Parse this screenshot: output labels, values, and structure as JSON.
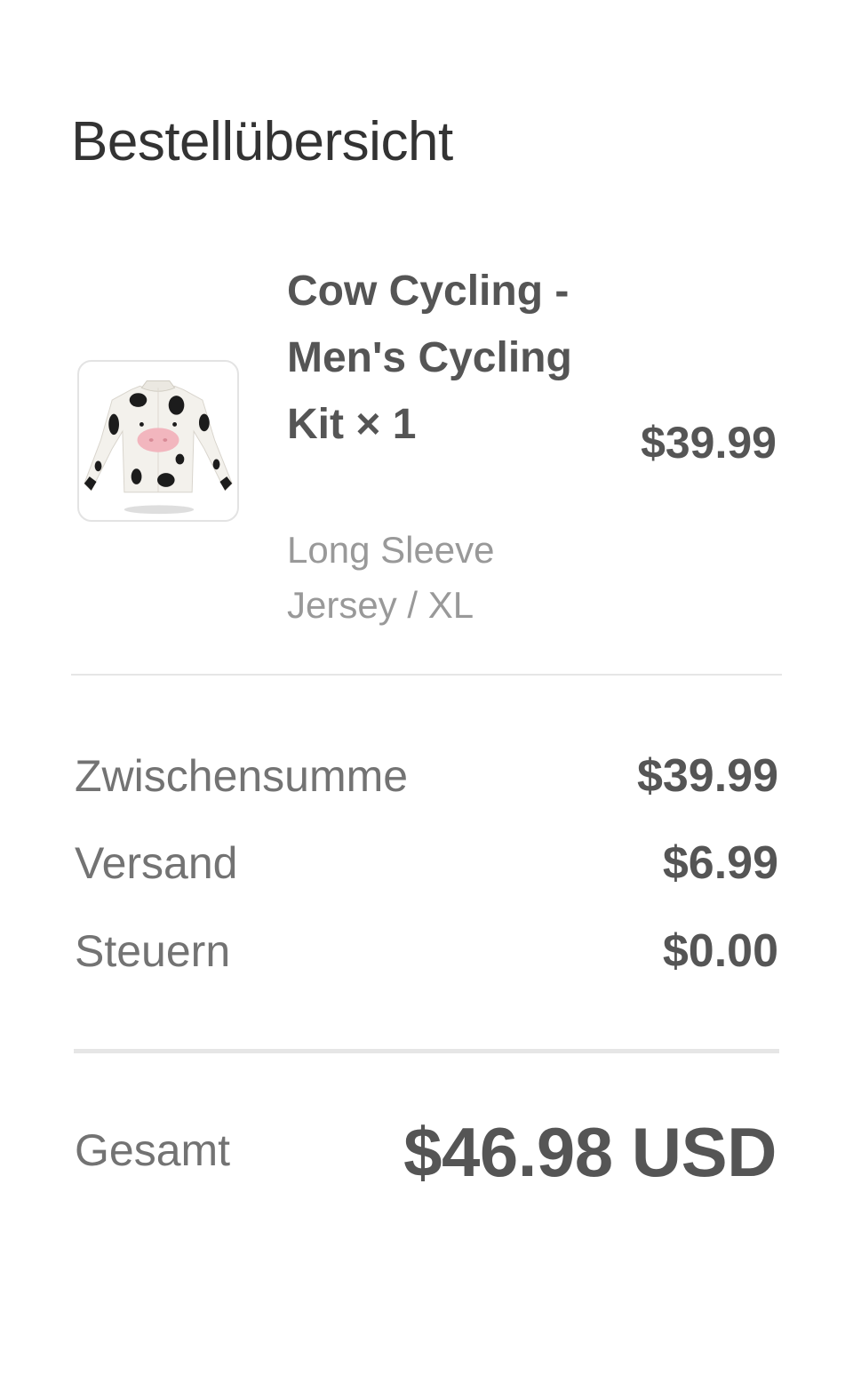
{
  "header": {
    "title": "Bestellübersicht"
  },
  "line_item": {
    "name": "Cow Cycling - Men's Cycling Kit × 1",
    "variant": "Long Sleeve Jersey / XL",
    "price": "$39.99",
    "image_icon": "cow-print-jersey-image"
  },
  "summary": {
    "subtotal_label": "Zwischensumme",
    "subtotal_value": "$39.99",
    "shipping_label": "Versand",
    "shipping_value": "$6.99",
    "taxes_label": "Steuern",
    "taxes_value": "$0.00"
  },
  "total": {
    "label": "Gesamt",
    "value": "$46.98 USD"
  },
  "colors": {
    "text_dark": "#555555",
    "text_muted": "#737373",
    "text_light": "#999999",
    "divider": "#e6e6e6"
  }
}
